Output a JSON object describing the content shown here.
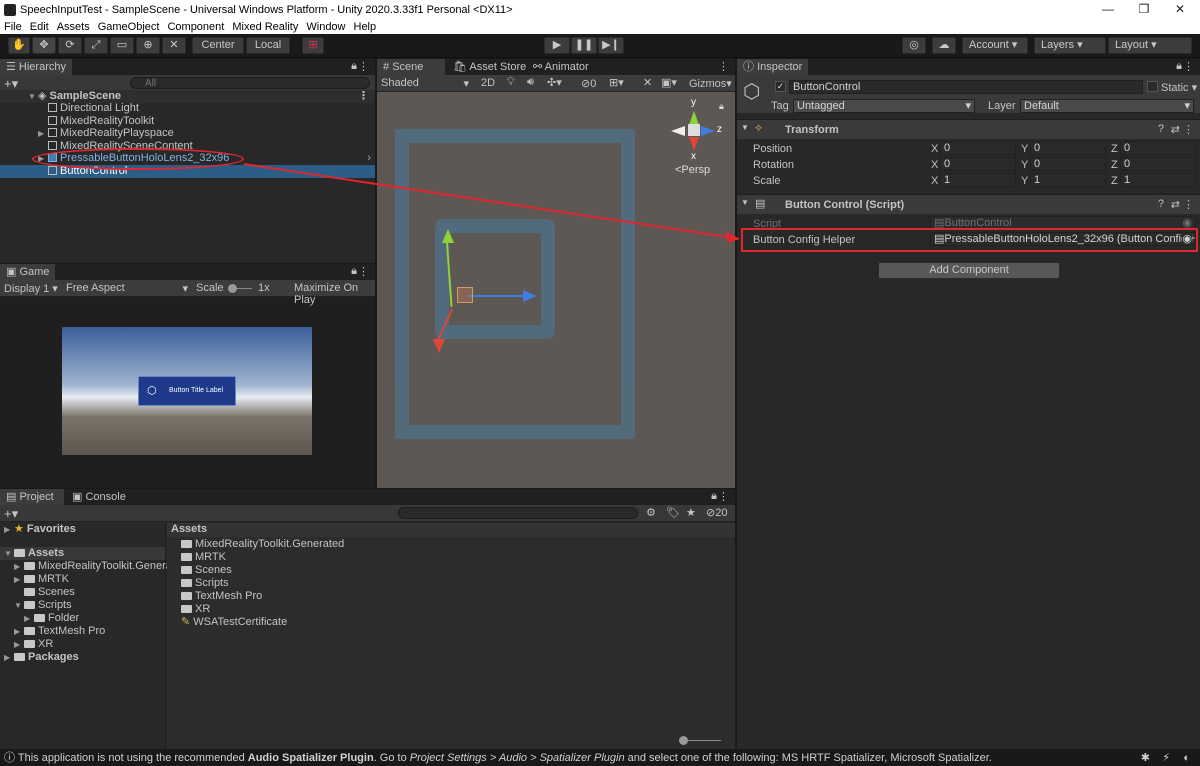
{
  "window": {
    "title": "SpeechInputTest - SampleScene - Universal Windows Platform - Unity 2020.3.33f1 Personal <DX11>",
    "minimize": "—",
    "restore": "❐",
    "close": "✕"
  },
  "menu": [
    "File",
    "Edit",
    "Assets",
    "GameObject",
    "Component",
    "Mixed Reality",
    "Window",
    "Help"
  ],
  "toolbar": {
    "center_label": "Center",
    "local_label": "Local",
    "account_label": "Account",
    "layers_label": "Layers",
    "layout_label": "Layout"
  },
  "hierarchy": {
    "tab_label": "Hierarchy",
    "search_placeholder": "All",
    "scene_name": "SampleScene",
    "items": [
      "Directional Light",
      "MixedRealityToolkit",
      "MixedRealityPlayspace",
      "MixedRealitySceneContent",
      "PressableButtonHoloLens2_32x96",
      "ButtonControl"
    ]
  },
  "scene": {
    "tabs": [
      "Scene",
      "Asset Store",
      "Animator"
    ],
    "shading": "Shaded",
    "mode_2d": "2D",
    "gizmos_label": "Gizmos",
    "hidden_count": "0",
    "persp_label": "<Persp",
    "axis_y": "y",
    "axis_x": "x",
    "axis_z": "z"
  },
  "game": {
    "tab_label": "Game",
    "display": "Display 1",
    "aspect": "Free Aspect",
    "scale_label": "Scale",
    "scale_value": "1x",
    "maximize_label": "Maximize On Play",
    "button_label": "Button Title Label"
  },
  "inspector": {
    "tab_label": "Inspector",
    "object_name": "ButtonControl",
    "static_label": "Static",
    "tag_label": "Tag",
    "tag_value": "Untagged",
    "layer_label": "Layer",
    "layer_value": "Default",
    "transform": {
      "title": "Transform",
      "position_label": "Position",
      "rotation_label": "Rotation",
      "scale_label": "Scale",
      "position": [
        "0",
        "0",
        "0"
      ],
      "rotation": [
        "0",
        "0",
        "0"
      ],
      "scale": [
        "1",
        "1",
        "1"
      ]
    },
    "script": {
      "title": "Button Control (Script)",
      "script_label": "Script",
      "script_value": "ButtonControl",
      "helper_label": "Button Config Helper",
      "helper_value": "PressableButtonHoloLens2_32x96 (Button Config H"
    },
    "add_component": "Add Component"
  },
  "project": {
    "tabs": [
      "Project",
      "Console"
    ],
    "hidden_count": "20",
    "favorites_label": "Favorites",
    "assets_label": "Assets",
    "tree": [
      "MixedRealityToolkit.Genera",
      "MRTK",
      "Scenes",
      "Scripts",
      "Folder",
      "TextMesh Pro",
      "XR"
    ],
    "packages_label": "Packages",
    "assets_header": "Assets",
    "assets_items": [
      "MixedRealityToolkit.Generated",
      "MRTK",
      "Scenes",
      "Scripts",
      "TextMesh Pro",
      "XR",
      "WSATestCertificate"
    ]
  },
  "status": {
    "p1": "This application is not using the recommended ",
    "b1": "Audio Spatializer Plugin",
    "p2": ". Go to ",
    "i1": "Project Settings > Audio > Spatializer Plugin",
    "p3": " and select one of the following: MS HRTF Spatializer, Microsoft Spatializer."
  }
}
